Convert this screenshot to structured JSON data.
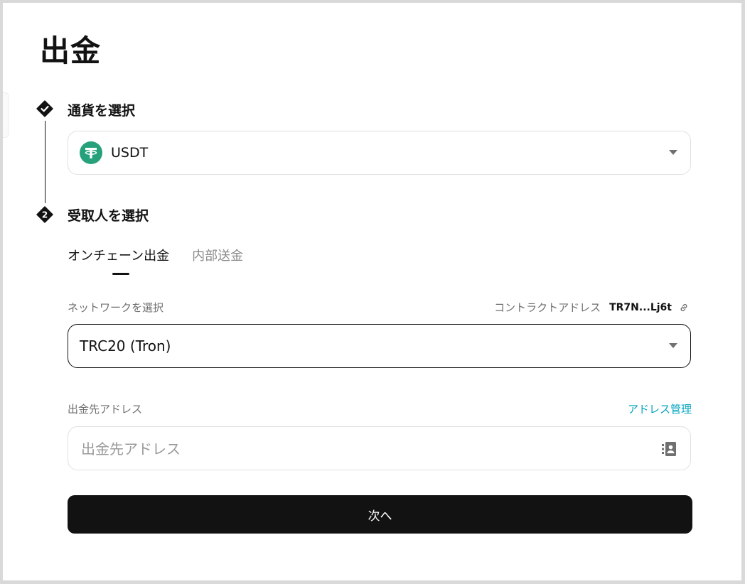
{
  "page": {
    "title": "出金"
  },
  "steps": [
    {
      "label": "通貨を選択",
      "state": "done",
      "icon": "check-icon"
    },
    {
      "label": "受取人を選択",
      "state": "current",
      "number": "2"
    }
  ],
  "currency": {
    "symbol": "USDT",
    "icon": "tether-icon",
    "icon_color": "#26a17b"
  },
  "tabs": [
    {
      "label": "オンチェーン出金",
      "active": true
    },
    {
      "label": "内部送金",
      "active": false
    }
  ],
  "network": {
    "label": "ネットワークを選択",
    "contract_label": "コントラクトアドレス",
    "contract_address": "TR7N...Lj6t",
    "selected": "TRC20 (Tron)"
  },
  "address": {
    "label": "出金先アドレス",
    "manage_link": "アドレス管理",
    "placeholder": "出金先アドレス",
    "value": ""
  },
  "next_button": {
    "label": "次へ"
  },
  "colors": {
    "primary": "#121212",
    "accent": "#00a3bf",
    "muted": "#707070"
  }
}
